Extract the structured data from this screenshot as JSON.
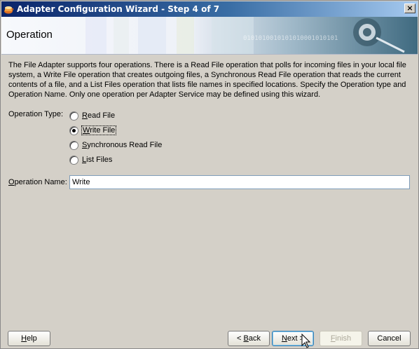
{
  "window": {
    "title": "Adapter Configuration Wizard - Step 4 of 7",
    "close_label": "×"
  },
  "banner": {
    "title": "Operation",
    "decor_text": "0101010010101010001010101"
  },
  "description": "The File Adapter supports four operations.  There is a Read File operation that polls for incoming files in your local file system, a Write File operation that creates outgoing files, a Synchronous Read File operation that reads the current contents of a file, and a List Files operation that lists file names in specified locations.  Specify the Operation type and Operation Name.  Only one operation per Adapter Service may be defined using this wizard.",
  "operation_type": {
    "label": "Operation Type:",
    "options": [
      {
        "label": "Read File",
        "mnemonic": "R",
        "rest": "ead File",
        "checked": false
      },
      {
        "label": "Write File",
        "mnemonic": "W",
        "rest": "rite File",
        "checked": true
      },
      {
        "label": "Synchronous Read File",
        "mnemonic": "S",
        "rest": "ynchronous Read File",
        "checked": false
      },
      {
        "label": "List Files",
        "mnemonic": "L",
        "rest": "ist Files",
        "checked": false
      }
    ]
  },
  "operation_name": {
    "label_mnemonic": "O",
    "label_rest": "peration Name:",
    "value": "Write"
  },
  "buttons": {
    "help": {
      "mnemonic": "H",
      "rest": "elp"
    },
    "back": {
      "prefix": "< ",
      "mnemonic": "B",
      "rest": "ack"
    },
    "next": {
      "mnemonic": "N",
      "rest": "ext >"
    },
    "finish": {
      "mnemonic": "F",
      "rest": "inish"
    },
    "cancel": {
      "label": "Cancel"
    }
  },
  "colors": {
    "titlebar_start": "#0a246a",
    "titlebar_end": "#a6caf0",
    "dialog_bg": "#d4d0c8"
  }
}
